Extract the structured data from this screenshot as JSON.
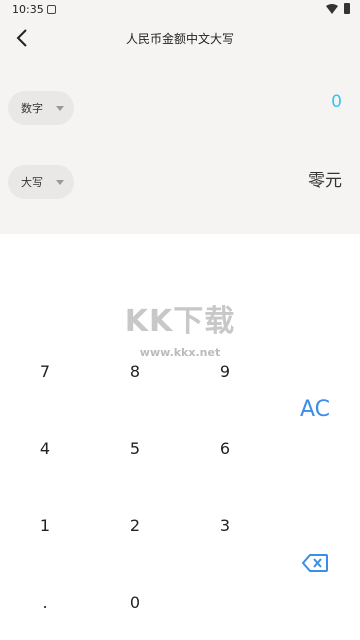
{
  "status": {
    "time": "10:35"
  },
  "header": {
    "title": "人民币金额中文大写"
  },
  "input_row": {
    "mode_label": "数字",
    "value": "0",
    "value_color": "#34c4f0"
  },
  "output_row": {
    "mode_label": "大写",
    "value": "零元"
  },
  "watermark": {
    "logo": "KK下载",
    "url": "www.kkx.net"
  },
  "keypad": {
    "keys": [
      "7",
      "8",
      "9",
      "4",
      "5",
      "6",
      "1",
      "2",
      "3",
      ".",
      "0"
    ],
    "clear_label": "AC",
    "accent_color": "#3a8ee6"
  }
}
